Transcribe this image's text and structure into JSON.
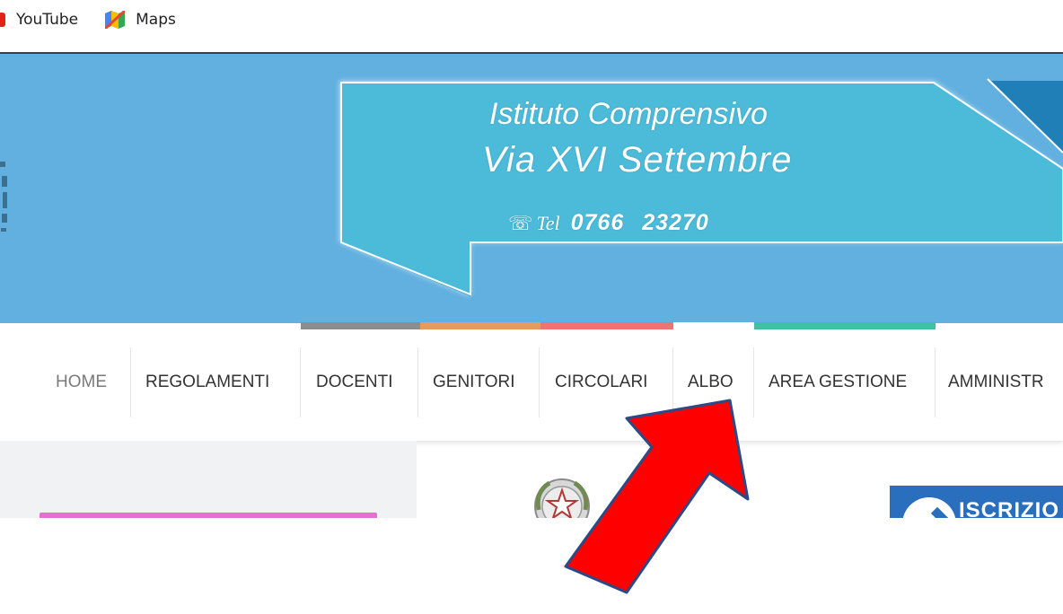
{
  "bookmarks": {
    "youtube": {
      "label": "YouTube",
      "icon": "youtube-icon"
    },
    "maps": {
      "label": "Maps",
      "icon": "google-maps-icon"
    }
  },
  "banner": {
    "line1": "Istituto Comprensivo",
    "line2": "Via XVI Settembre",
    "tel_label": "Tel",
    "tel_prefix": "0766",
    "tel_number": "23270",
    "phone_icon": "phone-icon",
    "background_color": "#62b0e0",
    "ribbon_color": "#4cbbd9"
  },
  "strip_colors": [
    "#8d8d8d",
    "#e89a5a",
    "#ee7474",
    "#ffffff",
    "#43c0a4"
  ],
  "nav": {
    "items": [
      {
        "label": "HOME"
      },
      {
        "label": "REGOLAMENTI"
      },
      {
        "label": "DOCENTI"
      },
      {
        "label": "GENITORI"
      },
      {
        "label": "CIRCOLARI"
      },
      {
        "label": "ALBO"
      },
      {
        "label": "AREA GESTIONE"
      },
      {
        "label": "AMMINISTR"
      }
    ]
  },
  "content": {
    "iscrizioni_label": "ISCRIZIO",
    "emblem_icon": "italian-republic-emblem-icon"
  },
  "annotation": {
    "arrow_color": "#ff0000",
    "arrow_target": "ALBO"
  }
}
